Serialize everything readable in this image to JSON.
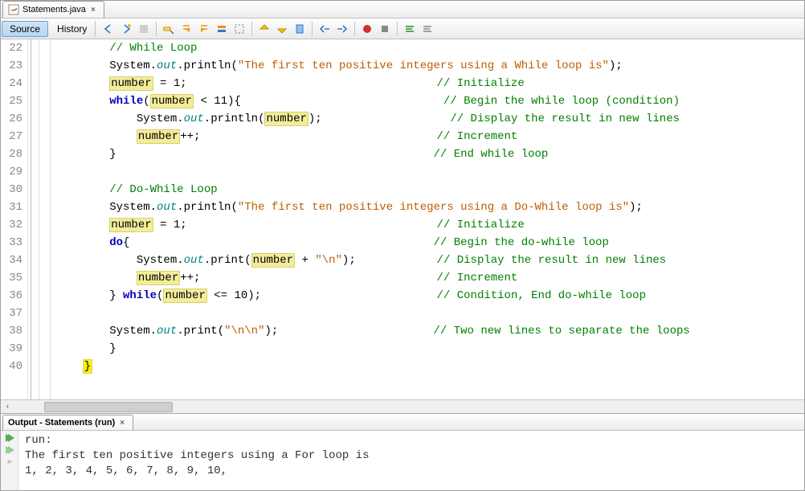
{
  "file_tab": {
    "label": "Statements.java"
  },
  "toolbar": {
    "source": "Source",
    "history": "History"
  },
  "lines": [
    {
      "n": 22,
      "segs": [
        {
          "t": "pad",
          "v": "        "
        },
        {
          "t": "cmt",
          "v": "// While Loop"
        }
      ]
    },
    {
      "n": 23,
      "segs": [
        {
          "t": "pad",
          "v": "        "
        },
        {
          "t": "id",
          "v": "System."
        },
        {
          "t": "fld",
          "v": "out"
        },
        {
          "t": "id",
          "v": ".println("
        },
        {
          "t": "str",
          "v": "\"The first ten positive integers using a While loop is\""
        },
        {
          "t": "id",
          "v": ");"
        }
      ]
    },
    {
      "n": 24,
      "segs": [
        {
          "t": "pad",
          "v": "        "
        },
        {
          "t": "hl",
          "v": "number"
        },
        {
          "t": "id",
          "v": " = 1;                                     "
        },
        {
          "t": "cmt",
          "v": "// Initialize"
        }
      ]
    },
    {
      "n": 25,
      "segs": [
        {
          "t": "pad",
          "v": "        "
        },
        {
          "t": "kw",
          "v": "while"
        },
        {
          "t": "id",
          "v": "("
        },
        {
          "t": "hl",
          "v": "number"
        },
        {
          "t": "id",
          "v": " < 11){                              "
        },
        {
          "t": "cmt",
          "v": "// Begin the while loop (condition)"
        }
      ]
    },
    {
      "n": 26,
      "segs": [
        {
          "t": "pad",
          "v": "            "
        },
        {
          "t": "id",
          "v": "System."
        },
        {
          "t": "fld",
          "v": "out"
        },
        {
          "t": "id",
          "v": ".println("
        },
        {
          "t": "hl",
          "v": "number"
        },
        {
          "t": "id",
          "v": ");                   "
        },
        {
          "t": "cmt",
          "v": "// Display the result in new lines"
        }
      ]
    },
    {
      "n": 27,
      "segs": [
        {
          "t": "pad",
          "v": "            "
        },
        {
          "t": "hl",
          "v": "number"
        },
        {
          "t": "id",
          "v": "++;                                   "
        },
        {
          "t": "cmt",
          "v": "// Increment"
        }
      ]
    },
    {
      "n": 28,
      "segs": [
        {
          "t": "pad",
          "v": "        "
        },
        {
          "t": "id",
          "v": "}                                               "
        },
        {
          "t": "cmt",
          "v": "// End while loop"
        }
      ]
    },
    {
      "n": 29,
      "segs": []
    },
    {
      "n": 30,
      "segs": [
        {
          "t": "pad",
          "v": "        "
        },
        {
          "t": "cmt",
          "v": "// Do-While Loop"
        }
      ]
    },
    {
      "n": 31,
      "segs": [
        {
          "t": "pad",
          "v": "        "
        },
        {
          "t": "id",
          "v": "System."
        },
        {
          "t": "fld",
          "v": "out"
        },
        {
          "t": "id",
          "v": ".println("
        },
        {
          "t": "str",
          "v": "\"The first ten positive integers using a Do-While loop is\""
        },
        {
          "t": "id",
          "v": ");"
        }
      ]
    },
    {
      "n": 32,
      "segs": [
        {
          "t": "pad",
          "v": "        "
        },
        {
          "t": "hl",
          "v": "number"
        },
        {
          "t": "id",
          "v": " = 1;                                     "
        },
        {
          "t": "cmt",
          "v": "// Initialize"
        }
      ]
    },
    {
      "n": 33,
      "segs": [
        {
          "t": "pad",
          "v": "        "
        },
        {
          "t": "kw",
          "v": "do"
        },
        {
          "t": "id",
          "v": "{                                             "
        },
        {
          "t": "cmt",
          "v": "// Begin the do-while loop"
        }
      ]
    },
    {
      "n": 34,
      "segs": [
        {
          "t": "pad",
          "v": "            "
        },
        {
          "t": "id",
          "v": "System."
        },
        {
          "t": "fld",
          "v": "out"
        },
        {
          "t": "id",
          "v": ".print("
        },
        {
          "t": "hl",
          "v": "number"
        },
        {
          "t": "id",
          "v": " + "
        },
        {
          "t": "str",
          "v": "\"\\n\""
        },
        {
          "t": "id",
          "v": ");            "
        },
        {
          "t": "cmt",
          "v": "// Display the result in new lines"
        }
      ]
    },
    {
      "n": 35,
      "segs": [
        {
          "t": "pad",
          "v": "            "
        },
        {
          "t": "hl",
          "v": "number"
        },
        {
          "t": "id",
          "v": "++;                                   "
        },
        {
          "t": "cmt",
          "v": "// Increment"
        }
      ]
    },
    {
      "n": 36,
      "segs": [
        {
          "t": "pad",
          "v": "        "
        },
        {
          "t": "id",
          "v": "} "
        },
        {
          "t": "kw",
          "v": "while"
        },
        {
          "t": "id",
          "v": "("
        },
        {
          "t": "hl",
          "v": "number"
        },
        {
          "t": "id",
          "v": " <= 10);                          "
        },
        {
          "t": "cmt",
          "v": "// Condition, End do-while loop"
        }
      ]
    },
    {
      "n": 37,
      "segs": []
    },
    {
      "n": 38,
      "segs": [
        {
          "t": "pad",
          "v": "        "
        },
        {
          "t": "id",
          "v": "System."
        },
        {
          "t": "fld",
          "v": "out"
        },
        {
          "t": "id",
          "v": ".print("
        },
        {
          "t": "str",
          "v": "\"\\n\\n\""
        },
        {
          "t": "id",
          "v": ");                       "
        },
        {
          "t": "cmt",
          "v": "// Two new lines to separate the loops"
        }
      ]
    },
    {
      "n": 39,
      "segs": [
        {
          "t": "pad",
          "v": "        "
        },
        {
          "t": "id",
          "v": "}"
        }
      ]
    },
    {
      "n": 40,
      "segs": [
        {
          "t": "pad",
          "v": "    "
        },
        {
          "t": "hls",
          "v": "}"
        }
      ]
    }
  ],
  "output": {
    "title": "Output - Statements (run)",
    "lines": [
      "run:",
      "The first ten positive integers using a For loop is",
      "1, 2, 3, 4, 5, 6, 7, 8, 9, 10,"
    ]
  }
}
